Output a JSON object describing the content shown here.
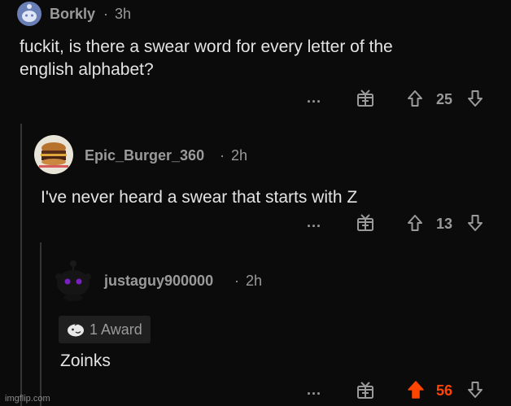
{
  "comments": [
    {
      "username": "Borkly",
      "separator": "·",
      "time": "3h",
      "body_lines": [
        "fuckit, is there a swear word for every letter of the",
        "english alphabet?"
      ],
      "more": "...",
      "votes": "25"
    },
    {
      "username": "Epic_Burger_360",
      "separator": "·",
      "time": "2h",
      "body_lines": [
        "I've never heard a swear that starts with Z"
      ],
      "more": "...",
      "votes": "13"
    },
    {
      "username": "justaguy900000",
      "separator": "·",
      "time": "2h",
      "award": "1 Award",
      "body_lines": [
        "Zoinks"
      ],
      "more": "...",
      "votes": "56"
    }
  ],
  "watermark": "imgflip.com",
  "colors": {
    "upvote_active": "#ff4500",
    "muted": "#9a9a9a",
    "background": "#0b0b0b"
  },
  "icons": [
    "avatar-snoo",
    "burger-avatar",
    "dark-snoo-avatar",
    "gift-icon",
    "upvote-icon",
    "downvote-icon",
    "award-icon"
  ]
}
